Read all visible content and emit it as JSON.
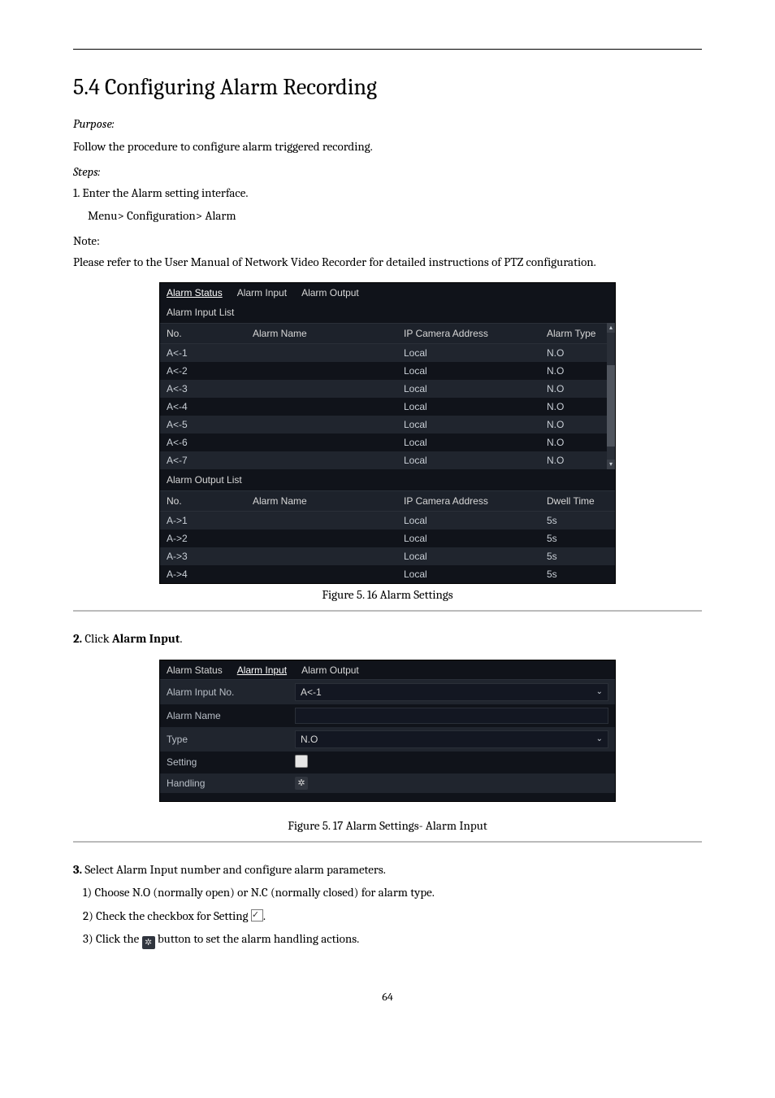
{
  "document": {
    "section_title": "5.4 Configuring Alarm Recording",
    "purpose_label": "Purpose:",
    "purpose_text": "Follow the procedure to configure alarm triggered recording.",
    "steps_label": "Steps:",
    "step1": "1. Enter the Alarm setting interface.",
    "step1_path": "Menu> Configuration> Alarm",
    "step2": "2. Click Alarm Input.",
    "step3_prefix": "3. Select Alarm Input number and configure alarm parameters.",
    "step3_line2": "1) Choose N.O (normally open) or N.C (normally closed) for alarm type.",
    "step3_line3_a": "2) Check the checkbox for Setting ",
    "step3_line3_b": ".",
    "step4_prefix": "3) Click the  ",
    "step4_suffix": "  button to set the alarm handling actions.",
    "note_label": "Note:",
    "note_text": "Please refer to the User Manual of Network Video Recorder for detailed instructions of PTZ configuration.",
    "caption1": "Figure 5. 16 Alarm Settings",
    "caption2": "Figure 5. 17 Alarm Settings- Alarm Input",
    "page_number": "64"
  },
  "shot1": {
    "tabs": [
      "Alarm Status",
      "Alarm Input",
      "Alarm Output"
    ],
    "active_tab_index": 0,
    "input_list_title": "Alarm Input List",
    "output_list_title": "Alarm Output List",
    "input_headers": [
      "No.",
      "Alarm Name",
      "IP Camera Address",
      "Alarm Type"
    ],
    "output_headers": [
      "No.",
      "Alarm Name",
      "IP Camera Address",
      "Dwell Time"
    ],
    "input_rows": [
      {
        "no": "A<-1",
        "name": "",
        "addr": "Local",
        "type": "N.O"
      },
      {
        "no": "A<-2",
        "name": "",
        "addr": "Local",
        "type": "N.O"
      },
      {
        "no": "A<-3",
        "name": "",
        "addr": "Local",
        "type": "N.O"
      },
      {
        "no": "A<-4",
        "name": "",
        "addr": "Local",
        "type": "N.O"
      },
      {
        "no": "A<-5",
        "name": "",
        "addr": "Local",
        "type": "N.O"
      },
      {
        "no": "A<-6",
        "name": "",
        "addr": "Local",
        "type": "N.O"
      },
      {
        "no": "A<-7",
        "name": "",
        "addr": "Local",
        "type": "N.O"
      }
    ],
    "output_rows": [
      {
        "no": "A->1",
        "name": "",
        "addr": "Local",
        "dwell": "5s"
      },
      {
        "no": "A->2",
        "name": "",
        "addr": "Local",
        "dwell": "5s"
      },
      {
        "no": "A->3",
        "name": "",
        "addr": "Local",
        "dwell": "5s"
      },
      {
        "no": "A->4",
        "name": "",
        "addr": "Local",
        "dwell": "5s"
      }
    ]
  },
  "shot2": {
    "tabs": [
      "Alarm Status",
      "Alarm Input",
      "Alarm Output"
    ],
    "active_tab_index": 1,
    "fields": {
      "alarm_input_no_label": "Alarm Input No.",
      "alarm_input_no_value": "A<-1",
      "alarm_name_label": "Alarm Name",
      "alarm_name_value": "",
      "type_label": "Type",
      "type_value": "N.O",
      "setting_label": "Setting",
      "handling_label": "Handling"
    }
  }
}
